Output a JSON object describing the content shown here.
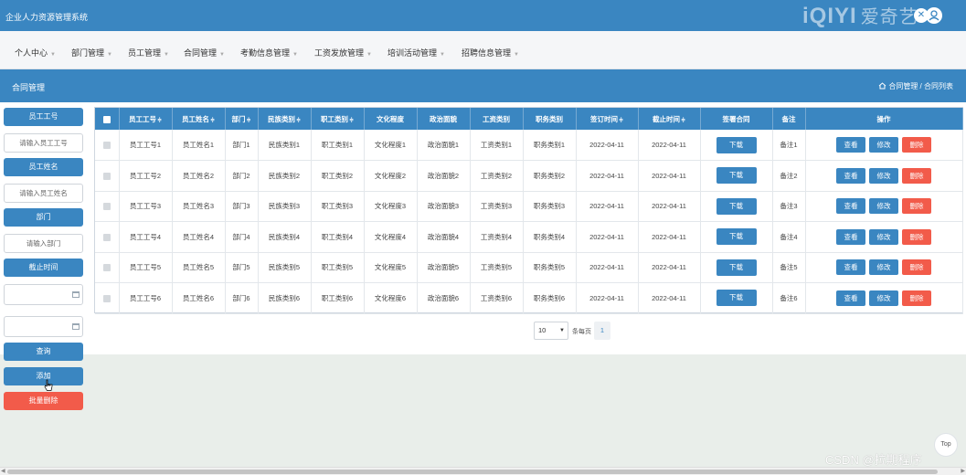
{
  "app": {
    "title": "企业人力资源管理系统",
    "watermark": "iQIYI",
    "watermark_cn": "爱奇艺"
  },
  "nav": {
    "items": [
      {
        "label": "个人中心"
      },
      {
        "label": "部门管理"
      },
      {
        "label": "员工管理"
      },
      {
        "label": "合同管理"
      },
      {
        "label": "考勤信息管理"
      },
      {
        "label": "工资发放管理"
      },
      {
        "label": "培训活动管理"
      },
      {
        "label": "招聘信息管理"
      }
    ]
  },
  "page": {
    "title": "合同管理",
    "breadcrumb": "合同管理 / 合同列表"
  },
  "sidebar": {
    "emp_no_label": "员工工号",
    "emp_no_placeholder": "请输入员工工号",
    "emp_name_label": "员工姓名",
    "emp_name_placeholder": "请输入员工姓名",
    "dept_label": "部门",
    "dept_placeholder": "请输入部门",
    "end_time_label": "截止时间",
    "query": "查询",
    "add": "添加",
    "batch_delete": "批量删除"
  },
  "table": {
    "headers": [
      "员工工号",
      "员工姓名",
      "部门",
      "民族类别",
      "职工类别",
      "文化程度",
      "政治面貌",
      "工资类别",
      "职务类别",
      "签订时间",
      "截止时间",
      "签署合同",
      "备注",
      "操作"
    ],
    "sort_mark": "≑",
    "rows": [
      {
        "emp_no": "员工工号1",
        "name": "员工姓名1",
        "dept": "部门1",
        "ethnic": "民族类别1",
        "staff": "职工类别1",
        "edu": "文化程度1",
        "political": "政治面貌1",
        "salary": "工资类别1",
        "duty": "职务类别1",
        "sign": "2022-04-11",
        "end": "2022-04-11",
        "download": "下载",
        "note": "备注1",
        "view": "查看",
        "edit": "修改",
        "delete": "删除"
      },
      {
        "emp_no": "员工工号2",
        "name": "员工姓名2",
        "dept": "部门2",
        "ethnic": "民族类别2",
        "staff": "职工类别2",
        "edu": "文化程度2",
        "political": "政治面貌2",
        "salary": "工资类别2",
        "duty": "职务类别2",
        "sign": "2022-04-11",
        "end": "2022-04-11",
        "download": "下载",
        "note": "备注2",
        "view": "查看",
        "edit": "修改",
        "delete": "删除"
      },
      {
        "emp_no": "员工工号3",
        "name": "员工姓名3",
        "dept": "部门3",
        "ethnic": "民族类别3",
        "staff": "职工类别3",
        "edu": "文化程度3",
        "political": "政治面貌3",
        "salary": "工资类别3",
        "duty": "职务类别3",
        "sign": "2022-04-11",
        "end": "2022-04-11",
        "download": "下载",
        "note": "备注3",
        "view": "查看",
        "edit": "修改",
        "delete": "删除"
      },
      {
        "emp_no": "员工工号4",
        "name": "员工姓名4",
        "dept": "部门4",
        "ethnic": "民族类别4",
        "staff": "职工类别4",
        "edu": "文化程度4",
        "political": "政治面貌4",
        "salary": "工资类别4",
        "duty": "职务类别4",
        "sign": "2022-04-11",
        "end": "2022-04-11",
        "download": "下载",
        "note": "备注4",
        "view": "查看",
        "edit": "修改",
        "delete": "删除"
      },
      {
        "emp_no": "员工工号5",
        "name": "员工姓名5",
        "dept": "部门5",
        "ethnic": "民族类别5",
        "staff": "职工类别5",
        "edu": "文化程度5",
        "political": "政治面貌5",
        "salary": "工资类别5",
        "duty": "职务类别5",
        "sign": "2022-04-11",
        "end": "2022-04-11",
        "download": "下载",
        "note": "备注5",
        "view": "查看",
        "edit": "修改",
        "delete": "删除"
      },
      {
        "emp_no": "员工工号6",
        "name": "员工姓名6",
        "dept": "部门6",
        "ethnic": "民族类别6",
        "staff": "职工类别6",
        "edu": "文化程度6",
        "political": "政治面貌6",
        "salary": "工资类别6",
        "duty": "职务类别6",
        "sign": "2022-04-11",
        "end": "2022-04-11",
        "download": "下载",
        "note": "备注6",
        "view": "查看",
        "edit": "修改",
        "delete": "删除"
      }
    ]
  },
  "pager": {
    "page_size": "10",
    "per_page_label": "条每页",
    "current_page": "1"
  },
  "footer": {
    "to_top": "Top",
    "csdn": "CSDN @拉期程序"
  },
  "colors": {
    "primary": "#3a86c1",
    "danger": "#f25b4a"
  },
  "icons": {
    "close": "close-icon",
    "user": "user-icon",
    "home": "home-icon",
    "calendar": "calendar-icon"
  }
}
